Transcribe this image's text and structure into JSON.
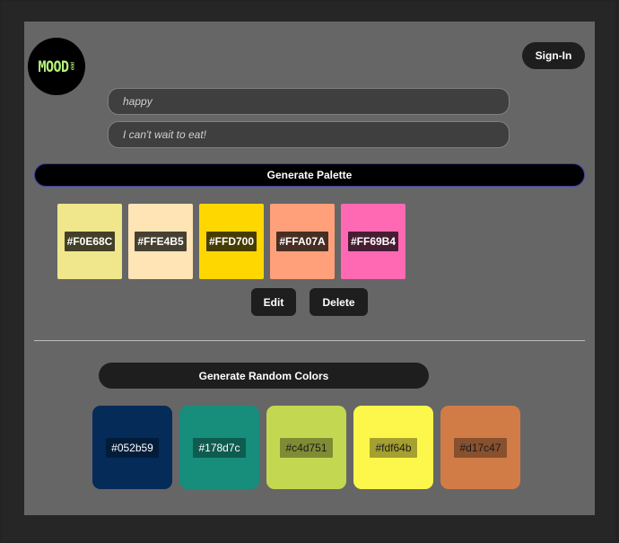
{
  "header": {
    "logo_text": "MOOD",
    "logo_small": "ppp",
    "signin_label": "Sign-In"
  },
  "inputs": {
    "mood_value": "happy",
    "description_value": "I can't wait to eat!"
  },
  "generate_palette_label": "Generate Palette",
  "palette": [
    {
      "hex": "#F0E68C",
      "color": "#F0E68C"
    },
    {
      "hex": "#FFE4B5",
      "color": "#FFE4B5"
    },
    {
      "hex": "#FFD700",
      "color": "#FFD700"
    },
    {
      "hex": "#FFA07A",
      "color": "#FFA07A"
    },
    {
      "hex": "#FF69B4",
      "color": "#FF69B4"
    }
  ],
  "actions": {
    "edit_label": "Edit",
    "delete_label": "Delete"
  },
  "generate_random_label": "Generate Random Colors",
  "random_colors": [
    {
      "hex": "#052b59",
      "color": "#052b59",
      "text_color": "#ffffff"
    },
    {
      "hex": "#178d7c",
      "color": "#178d7c",
      "text_color": "#ffffff"
    },
    {
      "hex": "#c4d751",
      "color": "#c4d751",
      "text_color": "#1a1a1a"
    },
    {
      "hex": "#fdf64b",
      "color": "#fdf64b",
      "text_color": "#1a1a1a"
    },
    {
      "hex": "#d17c47",
      "color": "#d17c47",
      "text_color": "#1a1a1a"
    }
  ]
}
